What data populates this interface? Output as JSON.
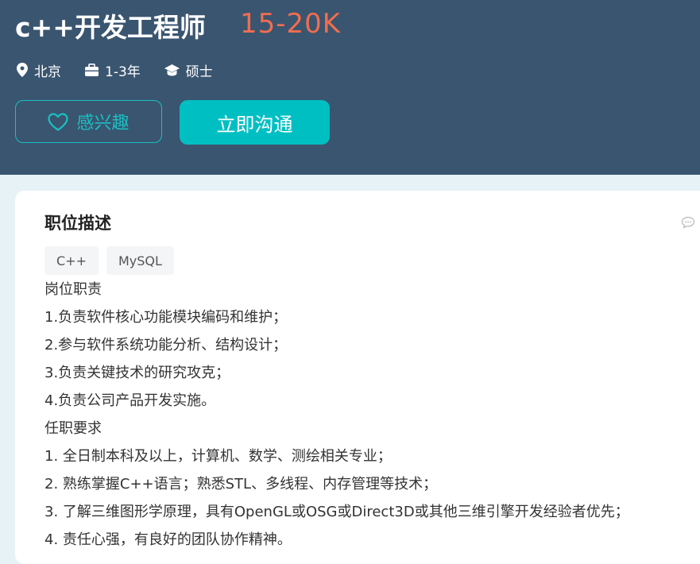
{
  "job": {
    "title": "c++开发工程师",
    "salary": "15-20K",
    "location": "北京",
    "experience": "1-3年",
    "degree": "硕士"
  },
  "actions": {
    "interest_label": "感兴趣",
    "chat_label": "立即沟通"
  },
  "description": {
    "section_title": "职位描述",
    "tags": [
      "C++",
      "MySQL"
    ],
    "lines": [
      "岗位职责",
      "1.负责软件核心功能模块编码和维护；",
      "2.参与软件系统功能分析、结构设计；",
      "3.负责关键技术的研究攻克；",
      "4.负责公司产品开发实施。",
      "任职要求",
      "1. 全日制本科及以上，计算机、数学、测绘相关专业；",
      "2. 熟练掌握C++语言；熟悉STL、多线程、内存管理等技术；",
      "3. 了解三维图形学原理，具有OpenGL或OSG或Direct3D或其他三维引擎开发经验者优先；",
      "4. 责任心强，有良好的团队协作精神。"
    ]
  },
  "icons": {
    "location": "map-pin-icon",
    "experience": "briefcase-icon",
    "degree": "graduation-cap-icon",
    "interest": "heart-icon",
    "feedback": "chat-bubble-icon"
  },
  "colors": {
    "header_bg": "#3a5570",
    "salary": "#f26d4f",
    "accent": "#00bfc3",
    "page_bg": "#e6f2f6"
  }
}
